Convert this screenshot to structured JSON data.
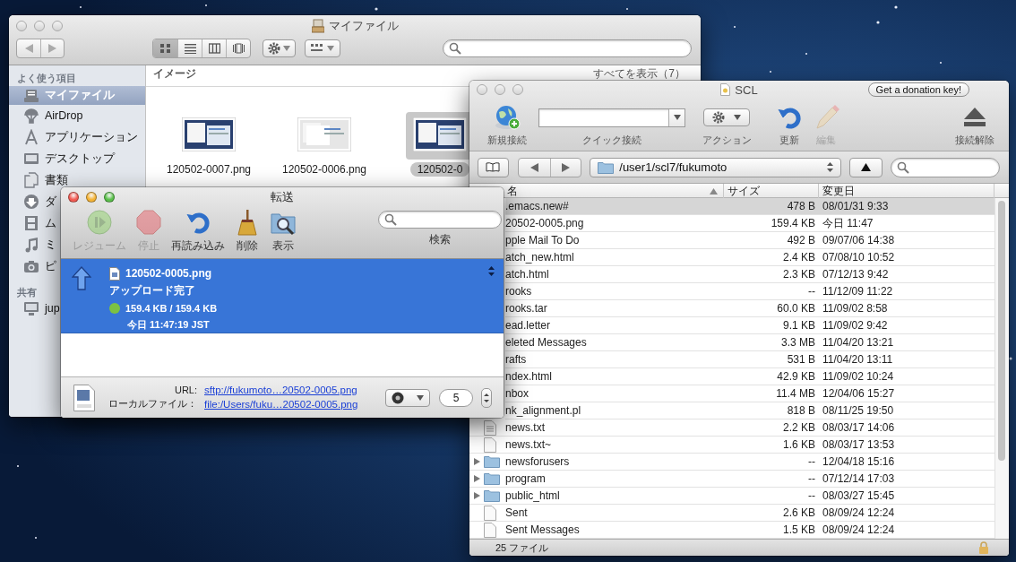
{
  "finder": {
    "title": "マイファイル",
    "active": false,
    "views": [
      {
        "kind": "icon",
        "selected": true
      },
      {
        "kind": "list",
        "selected": false
      },
      {
        "kind": "column",
        "selected": false
      },
      {
        "kind": "flow",
        "selected": false
      }
    ],
    "sidebar": [
      {
        "heading": "よく使う項目",
        "items": [
          {
            "label": "マイファイル",
            "selected": true
          },
          {
            "label": "AirDrop",
            "selected": false
          },
          {
            "label": "アプリケーション",
            "selected": false
          },
          {
            "label": "デスクトップ",
            "selected": false
          },
          {
            "label": "書類",
            "selected": false
          },
          {
            "label": "ダ",
            "selected": false
          },
          {
            "label": "ム",
            "selected": false
          },
          {
            "label": "ミ",
            "selected": false
          },
          {
            "label": "ピ",
            "selected": false
          }
        ]
      },
      {
        "heading": "共有",
        "items": [
          {
            "label": "jup",
            "selected": false
          }
        ]
      }
    ],
    "group": {
      "title": "イメージ",
      "show_all": "すべてを表示（7）"
    },
    "files": [
      {
        "name": "120502-0007.png",
        "selected": false
      },
      {
        "name": "120502-0006.png",
        "selected": false
      },
      {
        "name": "120502-0",
        "selected": true
      }
    ]
  },
  "transfer": {
    "title": "転送",
    "active": true,
    "tools": [
      {
        "label": "レジューム",
        "disabled": true
      },
      {
        "label": "停止",
        "disabled": true
      },
      {
        "label": "再読み込み",
        "disabled": false
      },
      {
        "label": "削除",
        "disabled": false
      },
      {
        "label": "表示",
        "disabled": false
      }
    ],
    "search_label": "検索",
    "items": [
      {
        "file": "120502-0005.png",
        "status": "アップロード完了",
        "progress": "159.4 KB / 159.4 KB",
        "time": "今日 11:47:19 JST",
        "color": "#7cc142",
        "selected": true
      }
    ],
    "url_label": "URL:",
    "url": "sftp://fukumoto…20502-0005.png",
    "local_label": "ローカルファイル：",
    "local": "file:/Users/fuku…20502-0005.png",
    "connections": "5"
  },
  "scl": {
    "title": "SCL",
    "active": false,
    "donation": "Get a donation key!",
    "toolbar": [
      {
        "kind": "button",
        "label": "新規接続",
        "disabled": false
      },
      {
        "kind": "combo",
        "label": "クイック接続"
      },
      {
        "kind": "popup",
        "label": "アクション"
      },
      {
        "kind": "button",
        "label": "更新",
        "disabled": false
      },
      {
        "kind": "button",
        "label": "編集",
        "disabled": true
      }
    ],
    "disconnect": "接続解除",
    "path": "/user1/scl7/fukumoto",
    "columns": [
      {
        "label": "名",
        "sorted": true
      },
      {
        "label": "サイズ",
        "sorted": false
      },
      {
        "label": "変更日",
        "sorted": false
      }
    ],
    "rows": [
      {
        "name": ".emacs.new#",
        "size": "478 B",
        "date": "08/01/31 9:33",
        "kind": "none",
        "selected": true
      },
      {
        "name": "20502-0005.png",
        "size": "159.4 KB",
        "date": "今日 11:47",
        "kind": "none",
        "selected": false
      },
      {
        "name": "pple Mail To Do",
        "size": "492 B",
        "date": "09/07/06 14:38",
        "kind": "none",
        "selected": false
      },
      {
        "name": "atch_new.html",
        "size": "2.4 KB",
        "date": "07/08/10 10:52",
        "kind": "none",
        "selected": false
      },
      {
        "name": "atch.html",
        "size": "2.3 KB",
        "date": "07/12/13 9:42",
        "kind": "none",
        "selected": false
      },
      {
        "name": "rooks",
        "size": "--",
        "date": "11/12/09 11:22",
        "kind": "none",
        "selected": false
      },
      {
        "name": "rooks.tar",
        "size": "60.0 KB",
        "date": "11/09/02 8:58",
        "kind": "none",
        "selected": false
      },
      {
        "name": "ead.letter",
        "size": "9.1 KB",
        "date": "11/09/02 9:42",
        "kind": "none",
        "selected": false
      },
      {
        "name": "eleted Messages",
        "size": "3.3 MB",
        "date": "11/04/20 13:21",
        "kind": "none",
        "selected": false
      },
      {
        "name": "rafts",
        "size": "531 B",
        "date": "11/04/20 13:11",
        "kind": "none",
        "selected": false
      },
      {
        "name": "ndex.html",
        "size": "42.9 KB",
        "date": "11/09/02 10:24",
        "kind": "none",
        "selected": false
      },
      {
        "name": "nbox",
        "size": "11.4 MB",
        "date": "12/04/06 15:27",
        "kind": "none",
        "selected": false
      },
      {
        "name": "nk_alignment.pl",
        "size": "818 B",
        "date": "08/11/25 19:50",
        "kind": "none",
        "selected": false
      },
      {
        "name": "news.txt",
        "size": "2.2 KB",
        "date": "08/03/17 14:06",
        "kind": "text",
        "selected": false
      },
      {
        "name": "news.txt~",
        "size": "1.6 KB",
        "date": "08/03/17 13:53",
        "kind": "file",
        "selected": false
      },
      {
        "name": "newsforusers",
        "size": "--",
        "date": "12/04/18 15:16",
        "kind": "folder",
        "expanded": false,
        "selected": false
      },
      {
        "name": "program",
        "size": "--",
        "date": "07/12/14 17:03",
        "kind": "folder",
        "expanded": false,
        "selected": false
      },
      {
        "name": "public_html",
        "size": "--",
        "date": "08/03/27 15:45",
        "kind": "folder",
        "expanded": false,
        "selected": false
      },
      {
        "name": "Sent",
        "size": "2.6 KB",
        "date": "08/09/24 12:24",
        "kind": "file",
        "selected": false
      },
      {
        "name": "Sent Messages",
        "size": "1.5 KB",
        "date": "08/09/24 12:24",
        "kind": "file",
        "selected": false
      }
    ],
    "status": "25 ファイル"
  }
}
